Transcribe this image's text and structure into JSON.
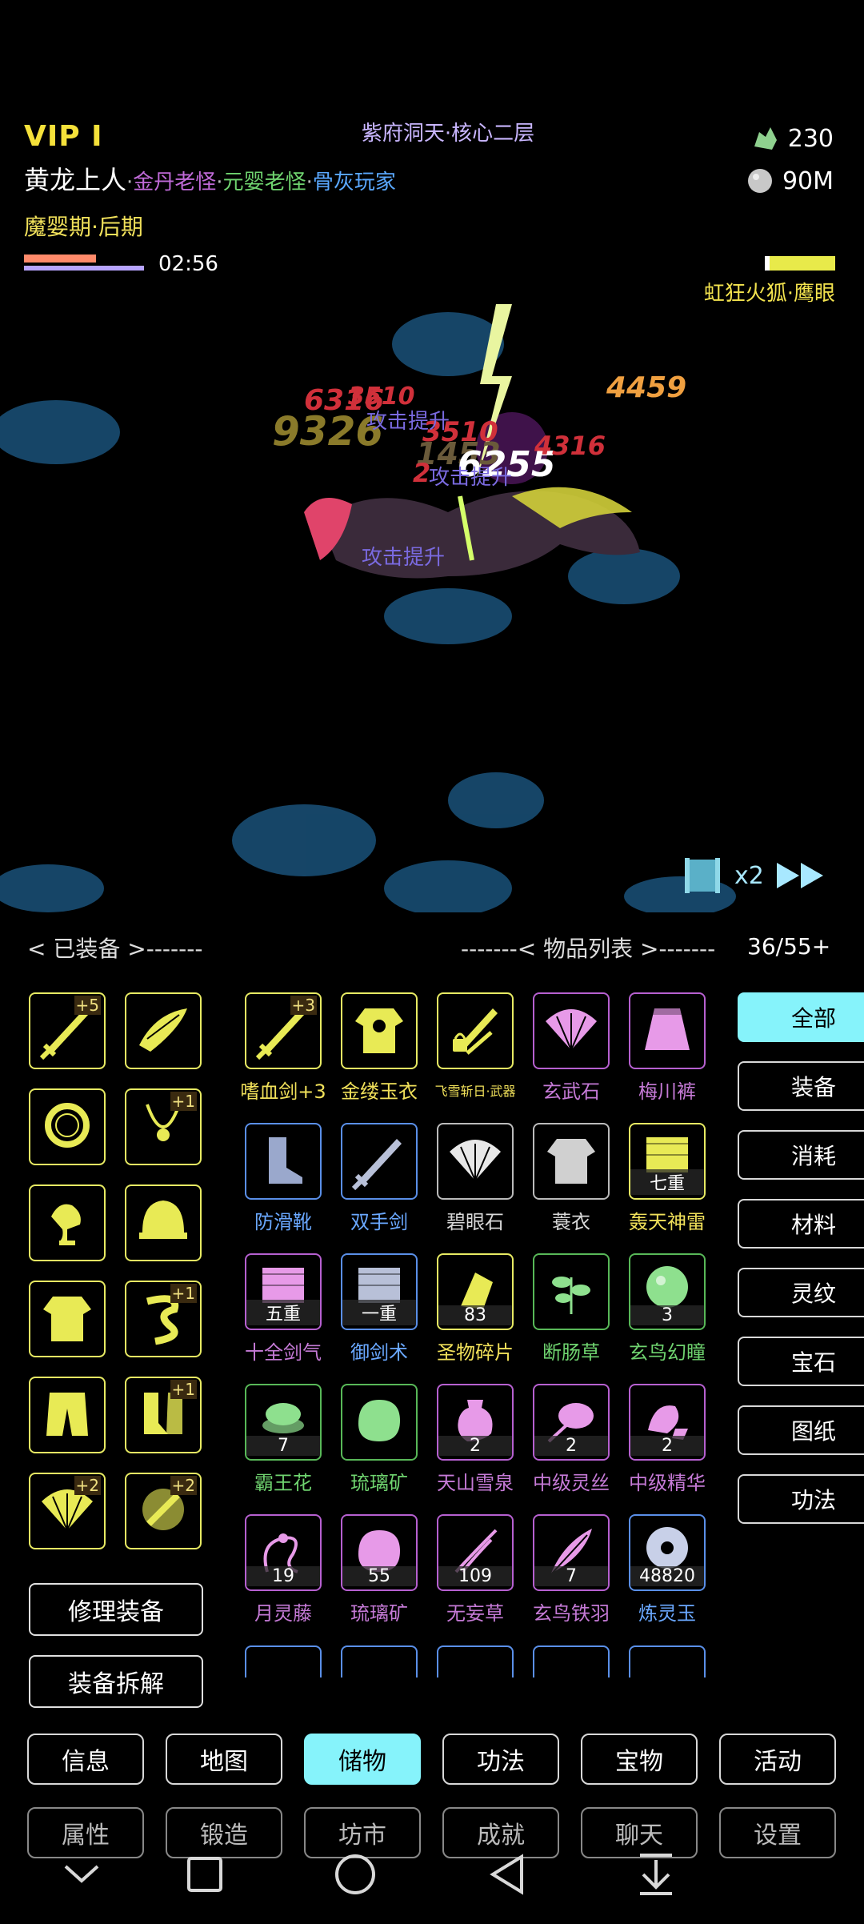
{
  "battle": {
    "vip": "VIP I",
    "map_name": "紫府洞天·核心二层",
    "player_name": "黄龙上人",
    "titles": [
      "金丹老怪",
      "元婴老怪",
      "骨灰玩家"
    ],
    "realm": "魔婴期·后期",
    "timer": "02:56",
    "resource_jade": "230",
    "resource_stone": "90M",
    "enemy_name": "虹狂火狐·鹰眼",
    "speed": "x2",
    "damage_numbers": [
      "6316",
      "3510",
      "9326",
      "3510",
      "1453",
      "6255",
      "4316",
      "2",
      "4459"
    ],
    "buff_texts": [
      "攻击提升",
      "攻击提升",
      "攻击提升"
    ],
    "player_hp_fraction": 0.6,
    "enemy_hp_fraction": 1.0
  },
  "inventory": {
    "equipped_header": "< 已装备 >-------",
    "list_header": "-------< 物品列表 >-------",
    "capacity": "36/55+",
    "equipped": [
      {
        "icon": "sword-icon",
        "plus": "+5"
      },
      {
        "icon": "scale-armor-icon",
        "plus": ""
      },
      {
        "icon": "ring-icon",
        "plus": ""
      },
      {
        "icon": "necklace-icon",
        "plus": "+1"
      },
      {
        "icon": "crane-icon",
        "plus": ""
      },
      {
        "icon": "helmet-icon",
        "plus": ""
      },
      {
        "icon": "robe-icon",
        "plus": ""
      },
      {
        "icon": "dragon-icon",
        "plus": "+1"
      },
      {
        "icon": "pants-icon",
        "plus": ""
      },
      {
        "icon": "boots-icon",
        "plus": "+1"
      },
      {
        "icon": "fan-icon",
        "plus": "+2"
      },
      {
        "icon": "talisman-icon",
        "plus": "+2"
      }
    ],
    "items": [
      {
        "name": "嗜血剑+3",
        "color": "#f0e05a",
        "border": "#e7ea63",
        "fill": "#e8ea55",
        "count": "",
        "plus": "+3",
        "icon": "sword-icon"
      },
      {
        "name": "金缕玉衣",
        "color": "#f0e05a",
        "border": "#e7ea63",
        "fill": "#e8ea55",
        "count": "",
        "plus": "",
        "icon": "armor-icon"
      },
      {
        "name": "飞雪斩日·武器",
        "color": "#f0e05a",
        "border": "#e7ea63",
        "fill": "#e8ea55",
        "count": "",
        "plus": "",
        "icon": "locked-sword-icon",
        "small": true
      },
      {
        "name": "玄武石",
        "color": "#c57ad6",
        "border": "#b660d0",
        "fill": "#e79ae8",
        "count": "",
        "plus": "",
        "icon": "fan-icon"
      },
      {
        "name": "梅川裤",
        "color": "#c57ad6",
        "border": "#b660d0",
        "fill": "#e79ae8",
        "count": "",
        "plus": "",
        "icon": "skirt-icon"
      },
      {
        "name": "防滑靴",
        "color": "#6aa8ff",
        "border": "#5a8fe8",
        "fill": "#9aa8cc",
        "count": "",
        "plus": "",
        "icon": "boot-icon"
      },
      {
        "name": "双手剑",
        "color": "#6aa8ff",
        "border": "#5a8fe8",
        "fill": "#b8c0d8",
        "count": "",
        "plus": "",
        "icon": "sword-icon"
      },
      {
        "name": "碧眼石",
        "color": "#d8d8d8",
        "border": "#bbbbbb",
        "fill": "#e8e8e8",
        "count": "",
        "plus": "",
        "icon": "fan-icon"
      },
      {
        "name": "蓑衣",
        "color": "#d8d8d8",
        "border": "#bbbbbb",
        "fill": "#d0d0d0",
        "count": "",
        "plus": "",
        "icon": "robe-icon"
      },
      {
        "name": "轰天神雷",
        "color": "#f0e05a",
        "border": "#e7ea63",
        "fill": "#e8ea55",
        "count": "七重",
        "plus": "",
        "icon": "scroll-icon"
      },
      {
        "name": "十全剑气",
        "color": "#c57ad6",
        "border": "#b660d0",
        "fill": "#e79ae8",
        "count": "五重",
        "plus": "",
        "icon": "scroll-icon"
      },
      {
        "name": "御剑术",
        "color": "#6aa8ff",
        "border": "#5a8fe8",
        "fill": "#b8c0d8",
        "count": "一重",
        "plus": "",
        "icon": "scroll-icon"
      },
      {
        "name": "圣物碎片",
        "color": "#f0e05a",
        "border": "#e7ea63",
        "fill": "#e8ea55",
        "count": "83",
        "plus": "",
        "icon": "shard-icon"
      },
      {
        "name": "断肠草",
        "color": "#6fd36f",
        "border": "#58b858",
        "fill": "#8ee08e",
        "count": "",
        "plus": "",
        "icon": "herb-icon"
      },
      {
        "name": "玄鸟幻瞳",
        "color": "#6fd36f",
        "border": "#58b858",
        "fill": "#8ee08e",
        "count": "3",
        "plus": "",
        "icon": "orb-icon"
      },
      {
        "name": "霸王花",
        "color": "#6fd36f",
        "border": "#58b858",
        "fill": "#8ee08e",
        "count": "7",
        "plus": "",
        "icon": "flower-icon"
      },
      {
        "name": "琉璃矿",
        "color": "#6fd36f",
        "border": "#58b858",
        "fill": "#8ee08e",
        "count": "",
        "plus": "",
        "icon": "ore-icon"
      },
      {
        "name": "天山雪泉",
        "color": "#c57ad6",
        "border": "#b660d0",
        "fill": "#e79ae8",
        "count": "2",
        "plus": "",
        "icon": "vase-icon"
      },
      {
        "name": "中级灵丝",
        "color": "#c57ad6",
        "border": "#b660d0",
        "fill": "#e79ae8",
        "count": "2",
        "plus": "",
        "icon": "silk-icon"
      },
      {
        "name": "中级精华",
        "color": "#c57ad6",
        "border": "#b660d0",
        "fill": "#e79ae8",
        "count": "2",
        "plus": "",
        "icon": "essence-icon"
      },
      {
        "name": "月灵藤",
        "color": "#c57ad6",
        "border": "#b660d0",
        "fill": "#e79ae8",
        "count": "19",
        "plus": "",
        "icon": "vine-icon"
      },
      {
        "name": "琉璃矿",
        "color": "#c57ad6",
        "border": "#b660d0",
        "fill": "#e79ae8",
        "count": "55",
        "plus": "",
        "icon": "ore-icon"
      },
      {
        "name": "无妄草",
        "color": "#c57ad6",
        "border": "#b660d0",
        "fill": "#e79ae8",
        "count": "109",
        "plus": "",
        "icon": "grass-icon"
      },
      {
        "name": "玄鸟铁羽",
        "color": "#c57ad6",
        "border": "#b660d0",
        "fill": "#e79ae8",
        "count": "7",
        "plus": "",
        "icon": "feather-icon"
      },
      {
        "name": "炼灵玉",
        "color": "#6aa8ff",
        "border": "#5a8fe8",
        "fill": "#c8d0e8",
        "count": "48820",
        "plus": "",
        "icon": "jade-icon"
      }
    ],
    "partial_row_borders": [
      "#5a8fe8",
      "#5a8fe8",
      "#5a8fe8",
      "#5a8fe8",
      "#5a8fe8"
    ],
    "categories": [
      "全部",
      "装备",
      "消耗",
      "材料",
      "灵纹",
      "宝石",
      "图纸",
      "功法"
    ],
    "active_category": 0,
    "repair_button": "修理装备",
    "dismantle_button": "装备拆解"
  },
  "nav": {
    "row1": [
      "信息",
      "地图",
      "储物",
      "功法",
      "宝物",
      "活动"
    ],
    "row2": [
      "属性",
      "锻造",
      "坊市",
      "成就",
      "聊天",
      "设置"
    ],
    "active": 2
  },
  "colors": {
    "accent": "#86f3fb",
    "legendary": "#e7ea63",
    "epic": "#b660d0",
    "rare": "#5a8fe8",
    "uncommon": "#58b858"
  }
}
